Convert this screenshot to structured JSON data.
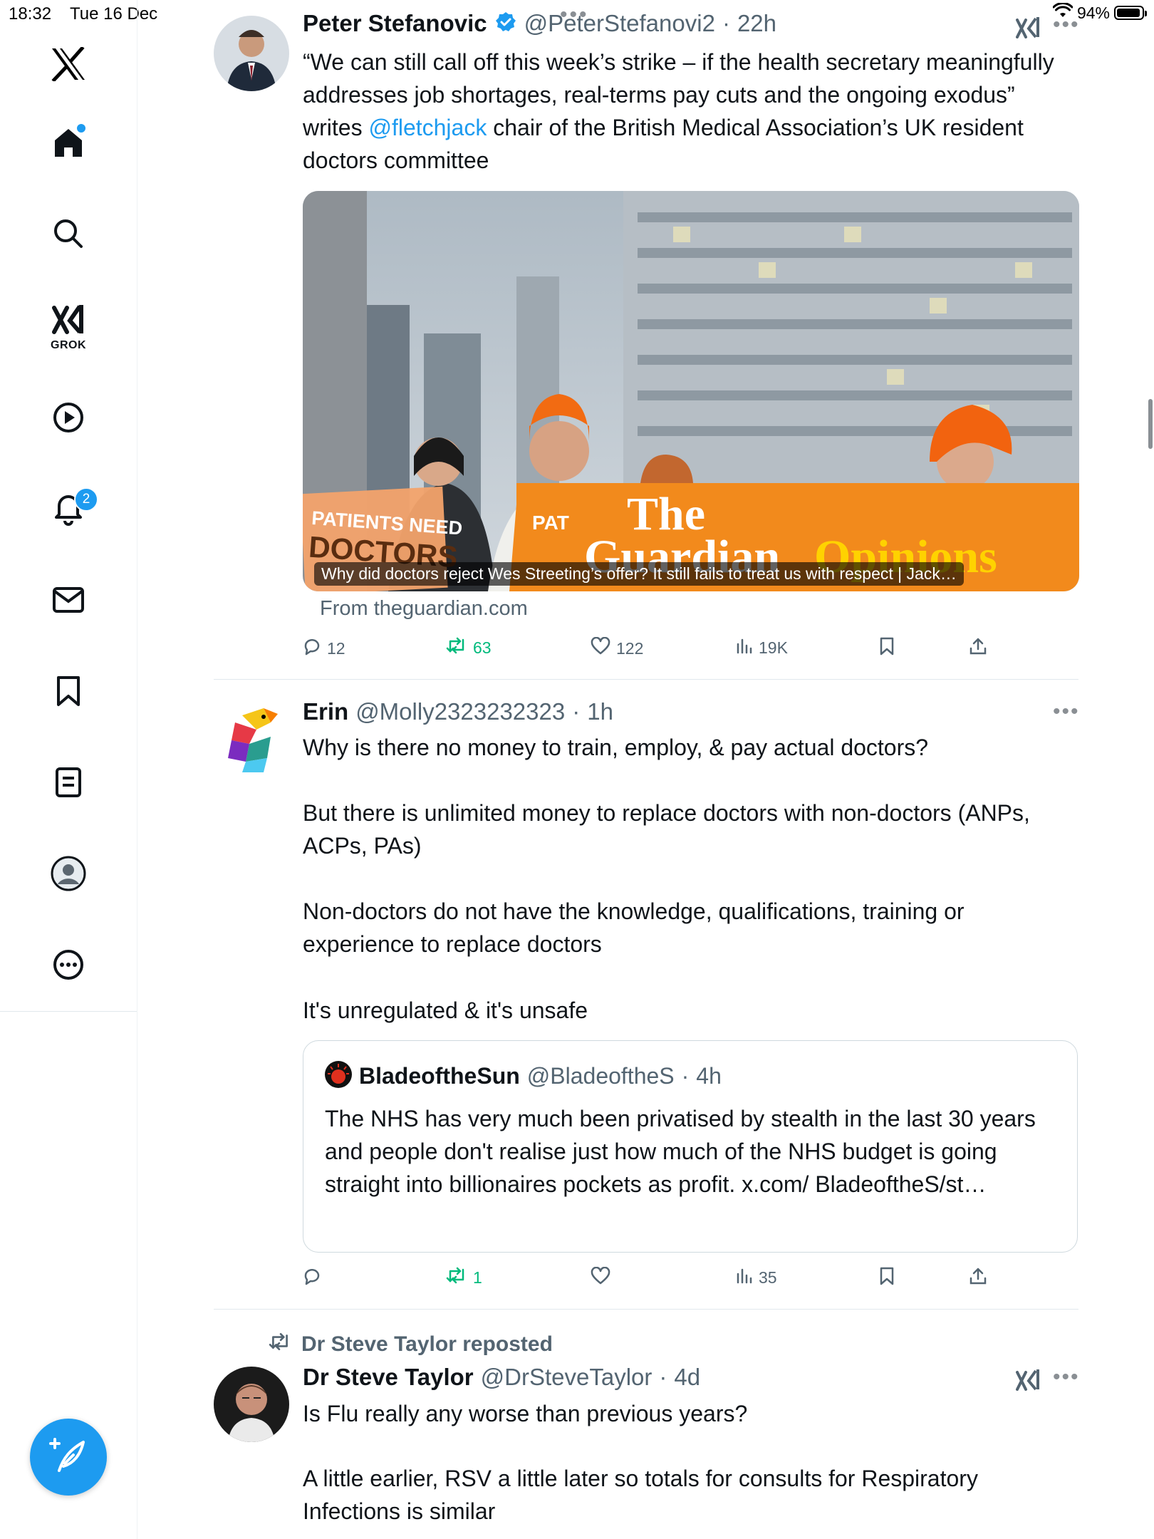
{
  "status_bar": {
    "time": "18:32",
    "date": "Tue 16 Dec",
    "battery": "94%",
    "battery_level": 0.94
  },
  "sidebar": {
    "items": [
      {
        "name": "x-logo",
        "icon": "x-logo-icon"
      },
      {
        "name": "home",
        "icon": "home-icon",
        "unread_dot": true
      },
      {
        "name": "search",
        "icon": "search-icon"
      },
      {
        "name": "grok",
        "icon": "grok-icon",
        "label": "GROK"
      },
      {
        "name": "video",
        "icon": "play-icon"
      },
      {
        "name": "notifications",
        "icon": "bell-icon",
        "badge": "2"
      },
      {
        "name": "messages",
        "icon": "mail-icon"
      },
      {
        "name": "bookmarks",
        "icon": "bookmark-icon"
      },
      {
        "name": "lists",
        "icon": "list-icon"
      },
      {
        "name": "profile",
        "icon": "profile-icon"
      },
      {
        "name": "more",
        "icon": "more-icon"
      }
    ],
    "compose_icon": "compose-icon"
  },
  "tweets": [
    {
      "name": "Peter Stefanovic",
      "verified": true,
      "handle": "@PeterStefanovi2",
      "sep": "·",
      "time": "22h",
      "text_before": "“We can still call off this week’s strike – if the health secretary meaningfully addresses job shortages, real-terms pay cuts and the ongoing exodus” writes ",
      "mention": "@fletchjack",
      "text_after": " chair of the British Medical Association’s UK resident doctors committee",
      "card": {
        "caption": "Why did doctors reject Wes Streeting’s offer? It still fails to treat us with respect | Jack…",
        "from": "From theguardian.com",
        "sign_left": "PATIENTS NEED",
        "sign_left2": "DOCTORS",
        "sign_mid": "PAT",
        "brand_1": "The",
        "brand_2": "Guardian",
        "brand_3": "Opinions"
      },
      "replies": "12",
      "reposts": "63",
      "likes": "122",
      "views": "19K"
    },
    {
      "name": "Erin",
      "handle": "@Molly2323232323",
      "sep": "·",
      "time": "1h",
      "paragraphs": [
        "Why is there no money to train, employ, & pay actual doctors?",
        "But there is unlimited money to replace doctors with non-doctors (ANPs, ACPs, PAs)",
        "Non-doctors do not have the knowledge, qualifications, training or experience to replace doctors",
        "It's unregulated & it's unsafe"
      ],
      "quote": {
        "name": "BladeoftheSun",
        "handle": "@BladeoftheS",
        "sep": "·",
        "time": "4h",
        "text": "The NHS has very much been privatised by stealth in the last 30 years and people don't realise just how much of the NHS budget is going straight into billionaires pockets as profit. x.com/ BladeoftheS/st…"
      },
      "replies": "",
      "reposts": "1",
      "likes": "",
      "views": "35"
    },
    {
      "repost_by": "Dr Steve Taylor reposted",
      "name": "Dr Steve Taylor",
      "handle": "@DrSteveTaylor",
      "sep": "·",
      "time": "4d",
      "paragraphs": [
        "Is Flu really any worse than previous years?",
        "A little earlier, RSV a little later so totals for consults for Respiratory Infections is similar"
      ]
    }
  ]
}
